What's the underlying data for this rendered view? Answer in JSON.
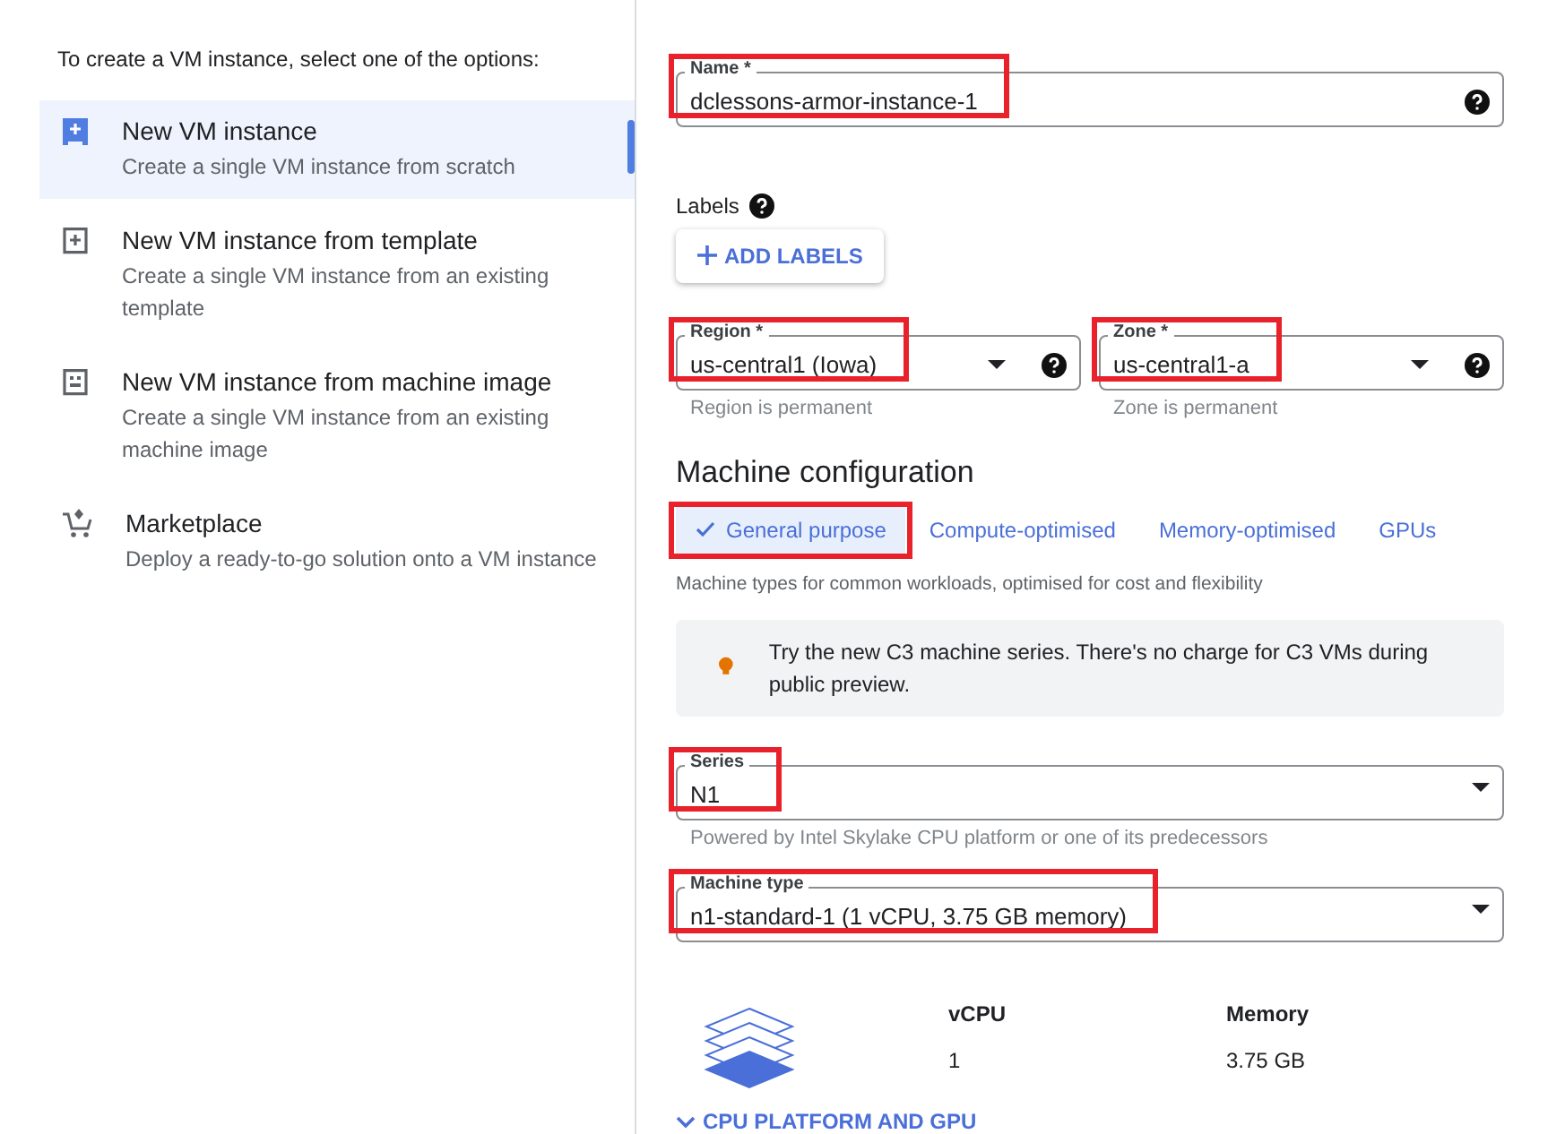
{
  "options_intro": "To create a VM instance, select one of the options:",
  "options": [
    {
      "kind": "new",
      "title": "New VM instance",
      "description": "Create a single VM instance from scratch",
      "selected": true
    },
    {
      "kind": "template",
      "title": "New VM instance from template",
      "description": "Create a single VM instance from an existing template",
      "selected": false
    },
    {
      "kind": "image",
      "title": "New VM instance from machine image",
      "description": "Create a single VM instance from an existing machine image",
      "selected": false
    },
    {
      "kind": "marketplace",
      "title": "Marketplace",
      "description": "Deploy a ready-to-go solution onto a VM instance",
      "selected": false
    }
  ],
  "name_field": {
    "label": "Name *",
    "value": "dclessons-armor-instance-1",
    "highlighted": true
  },
  "labels": {
    "title": "Labels",
    "button": "ADD LABELS"
  },
  "region_field": {
    "label": "Region *",
    "value": "us-central1 (Iowa)",
    "hint": "Region is permanent",
    "highlighted": true
  },
  "zone_field": {
    "label": "Zone *",
    "value": "us-central1-a",
    "hint": "Zone is permanent",
    "highlighted": true
  },
  "machine_config": {
    "title": "Machine configuration",
    "tabs": [
      {
        "label": "General purpose",
        "selected": true,
        "highlighted": true
      },
      {
        "label": "Compute-optimised",
        "selected": false,
        "highlighted": false
      },
      {
        "label": "Memory-optimised",
        "selected": false,
        "highlighted": false
      },
      {
        "label": "GPUs",
        "selected": false,
        "highlighted": false
      }
    ],
    "tab_description": "Machine types for common workloads, optimised for cost and flexibility",
    "notice": "Try the new C3 machine series. There's no charge for C3 VMs during public preview.",
    "series_field": {
      "label": "Series",
      "value": "N1",
      "hint": "Powered by Intel Skylake CPU platform or one of its predecessors",
      "highlighted": true
    },
    "machine_type_field": {
      "label": "Machine type",
      "value": "n1-standard-1 (1 vCPU, 3.75 GB memory)",
      "highlighted": true
    },
    "specs": [
      {
        "heading": "vCPU",
        "value": "1"
      },
      {
        "heading": "Memory",
        "value": "3.75 GB"
      }
    ],
    "expand_link": "CPU PLATFORM AND GPU"
  }
}
